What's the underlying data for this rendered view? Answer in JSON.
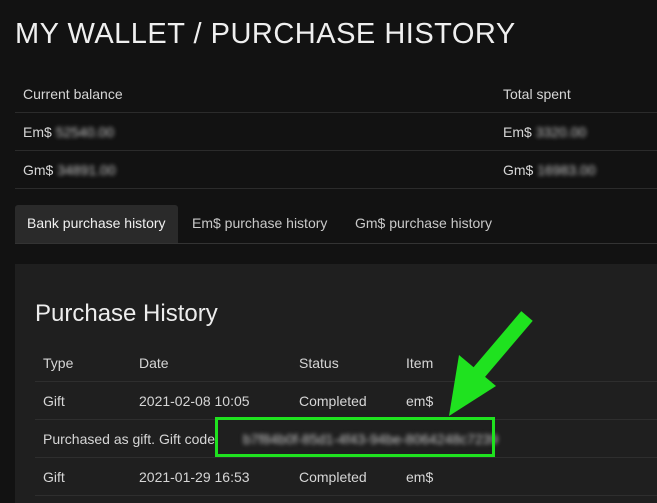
{
  "page_title": "MY WALLET / PURCHASE HISTORY",
  "balances": {
    "current_balance_label": "Current balance",
    "total_spent_label": "Total spent",
    "em_prefix": "Em$",
    "gm_prefix": "Gm$",
    "em_balance": "52540.00",
    "em_spent": "3320.00",
    "gm_balance": "34891.00",
    "gm_spent": "16983.00"
  },
  "tabs": [
    {
      "label": "Bank purchase history",
      "active": true
    },
    {
      "label": "Em$ purchase history",
      "active": false
    },
    {
      "label": "Gm$ purchase history",
      "active": false
    }
  ],
  "purchase_history": {
    "heading": "Purchase History",
    "columns": [
      "Type",
      "Date",
      "Status",
      "Item"
    ],
    "rows": [
      {
        "type": "Gift",
        "date": "2021-02-08 10:05",
        "status": "Completed",
        "item": "em$"
      },
      {
        "note": "Purchased as gift. Gift code:",
        "code": "b7f84b0f-85d1-4f43-94be-8064248c7239"
      },
      {
        "type": "Gift",
        "date": "2021-01-29 16:53",
        "status": "Completed",
        "item": "em$"
      }
    ]
  },
  "annotation": {
    "color": "#1fe21f"
  }
}
